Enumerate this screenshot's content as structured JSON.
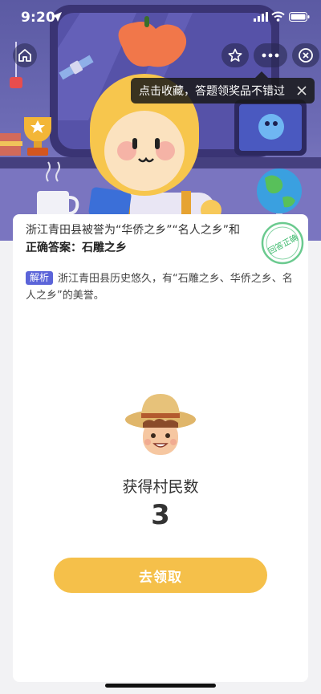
{
  "status_bar": {
    "time": "9:20",
    "icons": [
      "location-arrow-icon",
      "cellular-signal-icon",
      "wifi-icon",
      "battery-icon"
    ]
  },
  "nav": {
    "icons": [
      "home-icon",
      "star-icon",
      "more-icon",
      "close-circle-icon"
    ]
  },
  "tooltip": {
    "text": "点击收藏，答题领奖品不错过",
    "icon": "close-icon"
  },
  "quiz": {
    "question": "浙江青田县被誉为“华侨之乡”“名人之乡”和",
    "answer": "正确答案：石雕之乡",
    "stamp_text": "回答正确",
    "analysis_tag": "解析",
    "analysis_text": "浙江青田县历史悠久，有“石雕之乡、华侨之乡、名人之乡”的美誉。"
  },
  "reward": {
    "label": "获得村民数",
    "count": "3",
    "button_label": "去领取"
  },
  "colors": {
    "accent_button": "#f5c04a",
    "tag_blue": "#5b64d9",
    "stamp_green": "#39b86a",
    "hero_purple": "#5b5aa3"
  }
}
